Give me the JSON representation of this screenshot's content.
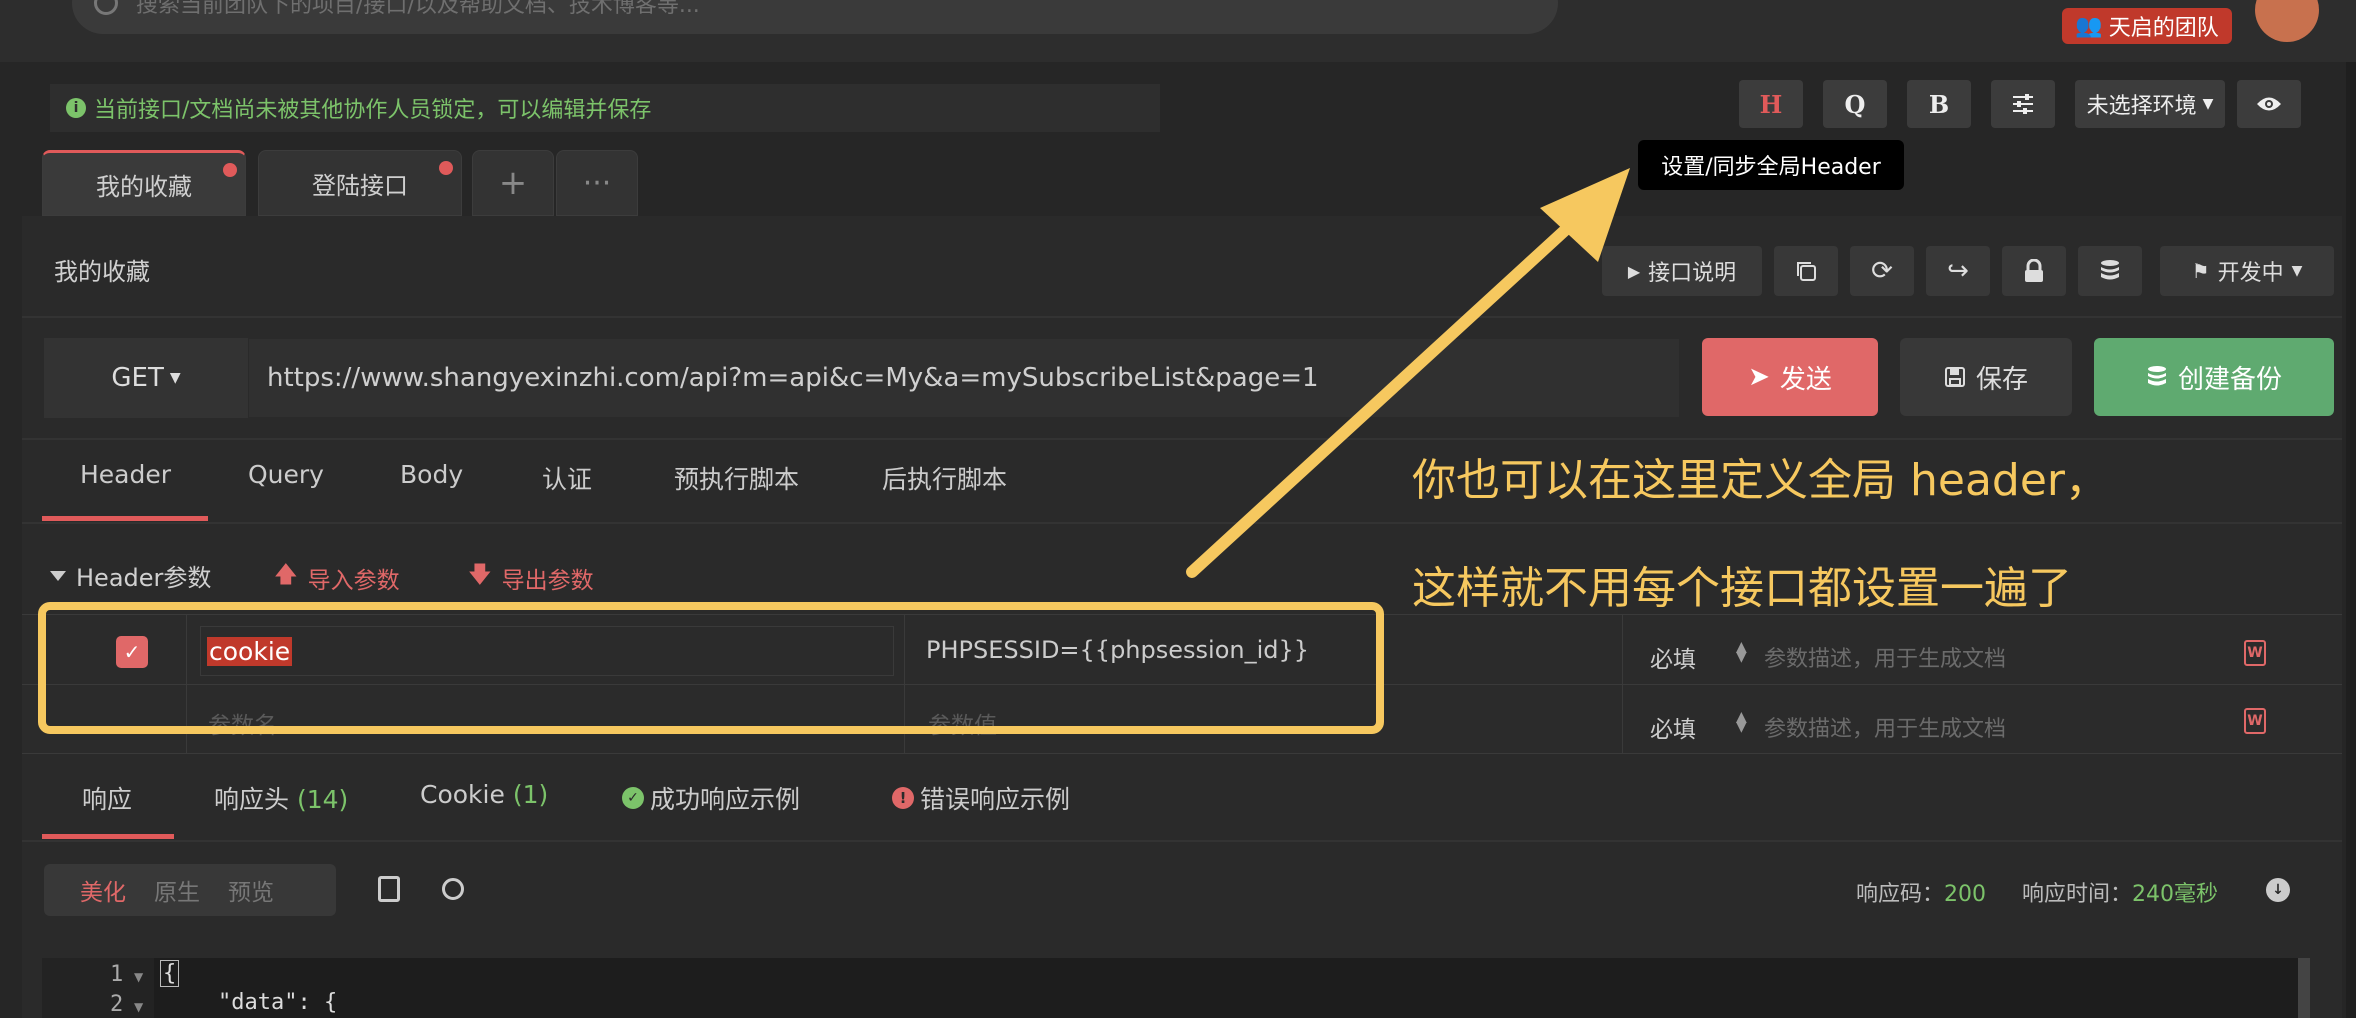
{
  "top": {
    "search_placeholder": "搜索当前团队下的项目/接口/以及帮助文档、技术博客等...",
    "team_label": "天启的团队"
  },
  "lock_notice": "当前接口/文档尚未被其他协作人员锁定，可以编辑并保存",
  "toolbar": {
    "h_label": "H",
    "q_label": "Q",
    "b_label": "B",
    "env_label": "未选择环境",
    "tooltip": "设置/同步全局Header"
  },
  "tabs": [
    {
      "label": "我的收藏"
    },
    {
      "label": "登陆接口"
    },
    {
      "label": "+"
    },
    {
      "label": "···"
    }
  ],
  "section": {
    "title": "我的收藏",
    "doc_button": "接口说明",
    "status_button": "开发中"
  },
  "request": {
    "method": "GET",
    "url": "https://www.shangyexinzhi.com/api?m=api&c=My&a=mySubscribeList&page=1",
    "send": "发送",
    "save": "保存",
    "backup": "创建备份"
  },
  "request_tabs": [
    "Header",
    "Query",
    "Body",
    "认证",
    "预执行脚本",
    "后执行脚本"
  ],
  "params": {
    "title": "Header参数",
    "import": "导入参数",
    "export": "导出参数",
    "rows": [
      {
        "name": "cookie",
        "value": "PHPSESSID={{phpsession_id}}",
        "required": "必填",
        "desc_placeholder": "参数描述，用于生成文档"
      },
      {
        "name_placeholder": "参数名",
        "value_placeholder": "参数值",
        "required": "必填",
        "desc_placeholder": "参数描述，用于生成文档"
      }
    ]
  },
  "response_tabs": {
    "resp": "响应",
    "headers": "响应头",
    "headers_count": "(14)",
    "cookie": "Cookie",
    "cookie_count": "(1)",
    "success": "成功响应示例",
    "error": "错误响应示例"
  },
  "view_modes": {
    "pretty": "美化",
    "raw": "原生",
    "preview": "预览"
  },
  "response_meta": {
    "code_label": "响应码：",
    "code": "200",
    "time_label": "响应时间：",
    "time": "240毫秒"
  },
  "code": {
    "line1": "1",
    "line2": "2",
    "text1": "{",
    "text2": "\"data\": {"
  },
  "annotation": {
    "line1": "你也可以在这里定义全局 header，",
    "line2": "这样就不用每个接口都设置一遍了",
    "color": "#f6c85f"
  }
}
